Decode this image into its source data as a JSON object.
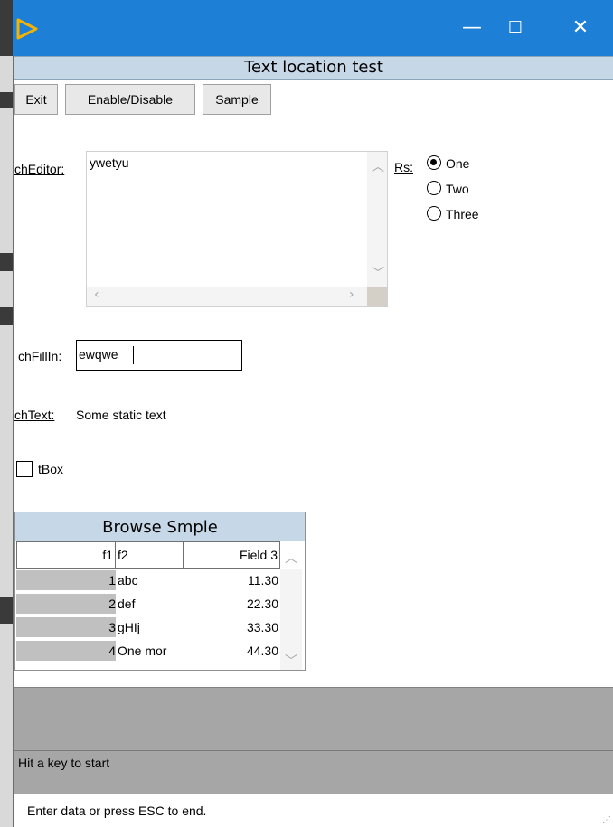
{
  "window": {
    "caption": "Text location test",
    "minimize_glyph": "—",
    "maximize_glyph": "☐",
    "close_glyph": "✕"
  },
  "toolbar": {
    "exit_label": "Exit",
    "enable_disable_label": "Enable/Disable",
    "sample_label": "Sample"
  },
  "editor": {
    "label": "chEditor:",
    "value": "ywetyu"
  },
  "radio_set": {
    "label": "Rs:",
    "options": [
      {
        "label": "One",
        "selected": true
      },
      {
        "label": "Two",
        "selected": false
      },
      {
        "label": "Three",
        "selected": false
      }
    ]
  },
  "fillin": {
    "label": "chFillIn:",
    "value": "ewqwe"
  },
  "static_text": {
    "label": "chText:",
    "value": "Some static text"
  },
  "checkbox": {
    "label": "tBox",
    "checked": false
  },
  "browse": {
    "title": "Browse Smple",
    "columns": [
      "f1",
      "f2",
      "Field 3"
    ],
    "rows": [
      {
        "f1": "1",
        "f2": "abc",
        "f3": "11.30"
      },
      {
        "f1": "2",
        "f2": "def",
        "f3": "22.30"
      },
      {
        "f1": "3",
        "f2": "gHIj",
        "f3": "33.30"
      },
      {
        "f1": "4",
        "f2": "One mor",
        "f3": "44.30"
      }
    ]
  },
  "message_area": {
    "message": "Hit a key to start"
  },
  "status": {
    "text": "Enter data or press ESC to end."
  },
  "icons": {
    "app": "play-triangle-icon",
    "scroll_up": "chevron-up-icon",
    "scroll_down": "chevron-down-icon",
    "scroll_left": "chevron-left-icon",
    "scroll_right": "chevron-right-icon"
  },
  "colors": {
    "titlebar": "#1e7fd6",
    "caption_bar": "#c6d8e8",
    "message_area": "#a6a6a6",
    "row_number_bg": "#c0c0c0"
  }
}
